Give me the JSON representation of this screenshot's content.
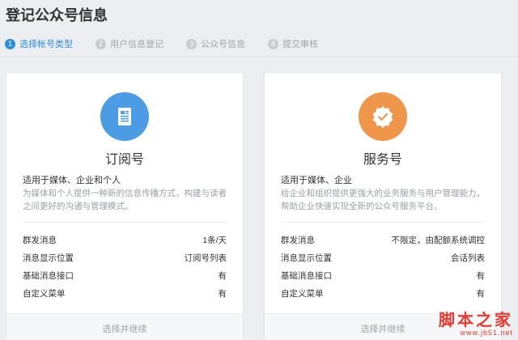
{
  "page": {
    "title": "登记公众号信息"
  },
  "steps": [
    {
      "num": "1",
      "label": "选择帐号类型",
      "active": true
    },
    {
      "num": "2",
      "label": "用户信息登记",
      "active": false
    },
    {
      "num": "3",
      "label": "公众号信息",
      "active": false
    },
    {
      "num": "4",
      "label": "提交审核",
      "active": false
    }
  ],
  "cards": [
    {
      "title": "订阅号",
      "icon": "document-icon",
      "icon_color": "#4b9be5",
      "subtitle": "适用于媒体、企业和个人",
      "description": "为媒体和个人提供一种新的信息传播方式，构建与读者之间更好的沟通与管理模式。",
      "features": [
        {
          "label": "群发消息",
          "value": "1条/天"
        },
        {
          "label": "消息显示位置",
          "value": "订阅号列表"
        },
        {
          "label": "基础消息接口",
          "value": "有"
        },
        {
          "label": "自定义菜单",
          "value": "有"
        }
      ],
      "footer": "选择并继续"
    },
    {
      "title": "服务号",
      "icon": "badge-check-icon",
      "icon_color": "#f0964a",
      "subtitle": "适用于媒体、企业",
      "description": "给企业和组织提供更强大的业务服务与用户管理能力，帮助企业快速实现全新的公众号服务平台。",
      "features": [
        {
          "label": "群发消息",
          "value": "不限定，由配额系统调控"
        },
        {
          "label": "消息显示位置",
          "value": "会话列表"
        },
        {
          "label": "基础消息接口",
          "value": "有"
        },
        {
          "label": "自定义菜单",
          "value": "有"
        }
      ],
      "footer": "选择并继续"
    }
  ],
  "watermark": {
    "text": "脚本之家",
    "url": "www.jb51.net"
  }
}
